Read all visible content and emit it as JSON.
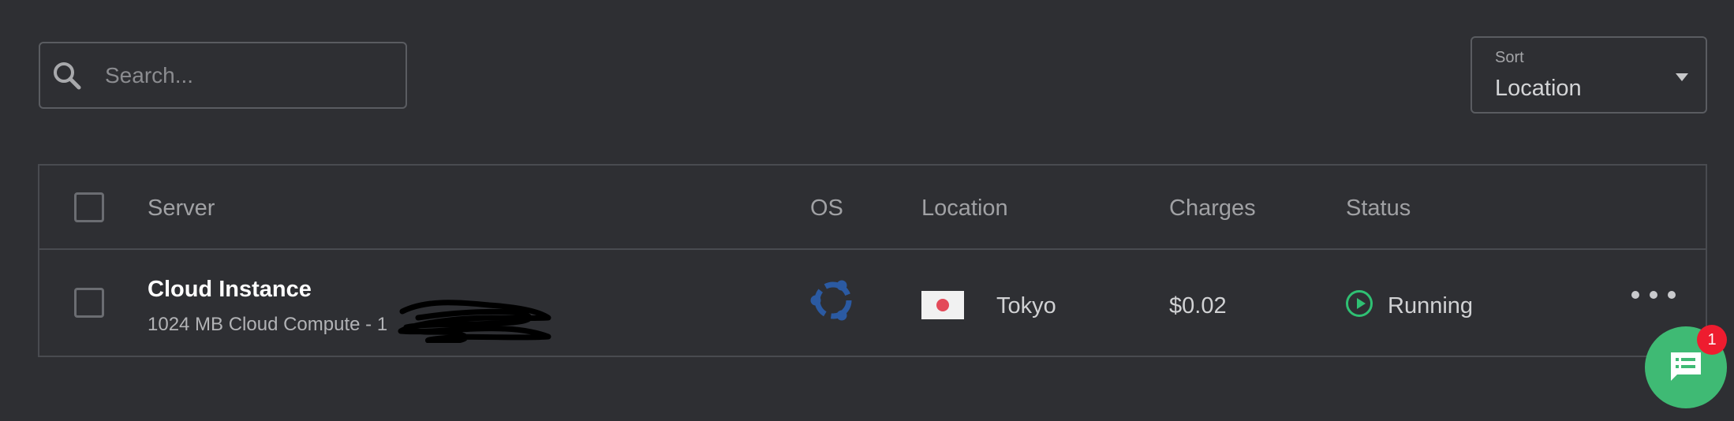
{
  "search": {
    "placeholder": "Search...",
    "value": ""
  },
  "sort": {
    "label": "Sort",
    "value": "Location"
  },
  "table": {
    "columns": [
      "Server",
      "OS",
      "Location",
      "Charges",
      "Status"
    ],
    "rows": [
      {
        "name": "Cloud Instance",
        "description": "1024 MB Cloud Compute - 1",
        "os_icon": "ubuntu-logo-icon",
        "location_flag": "japan-flag-icon",
        "location": "Tokyo",
        "charges": "$0.02",
        "status": "Running",
        "status_icon": "play-circle-icon"
      }
    ]
  },
  "chat": {
    "badge_count": "1"
  },
  "colors": {
    "background": "#2e2f33",
    "running_green": "#2fc073",
    "ubuntu_blue": "#2b5aa2",
    "chat_green": "#3fba74",
    "badge_red": "#ee1c2f"
  }
}
